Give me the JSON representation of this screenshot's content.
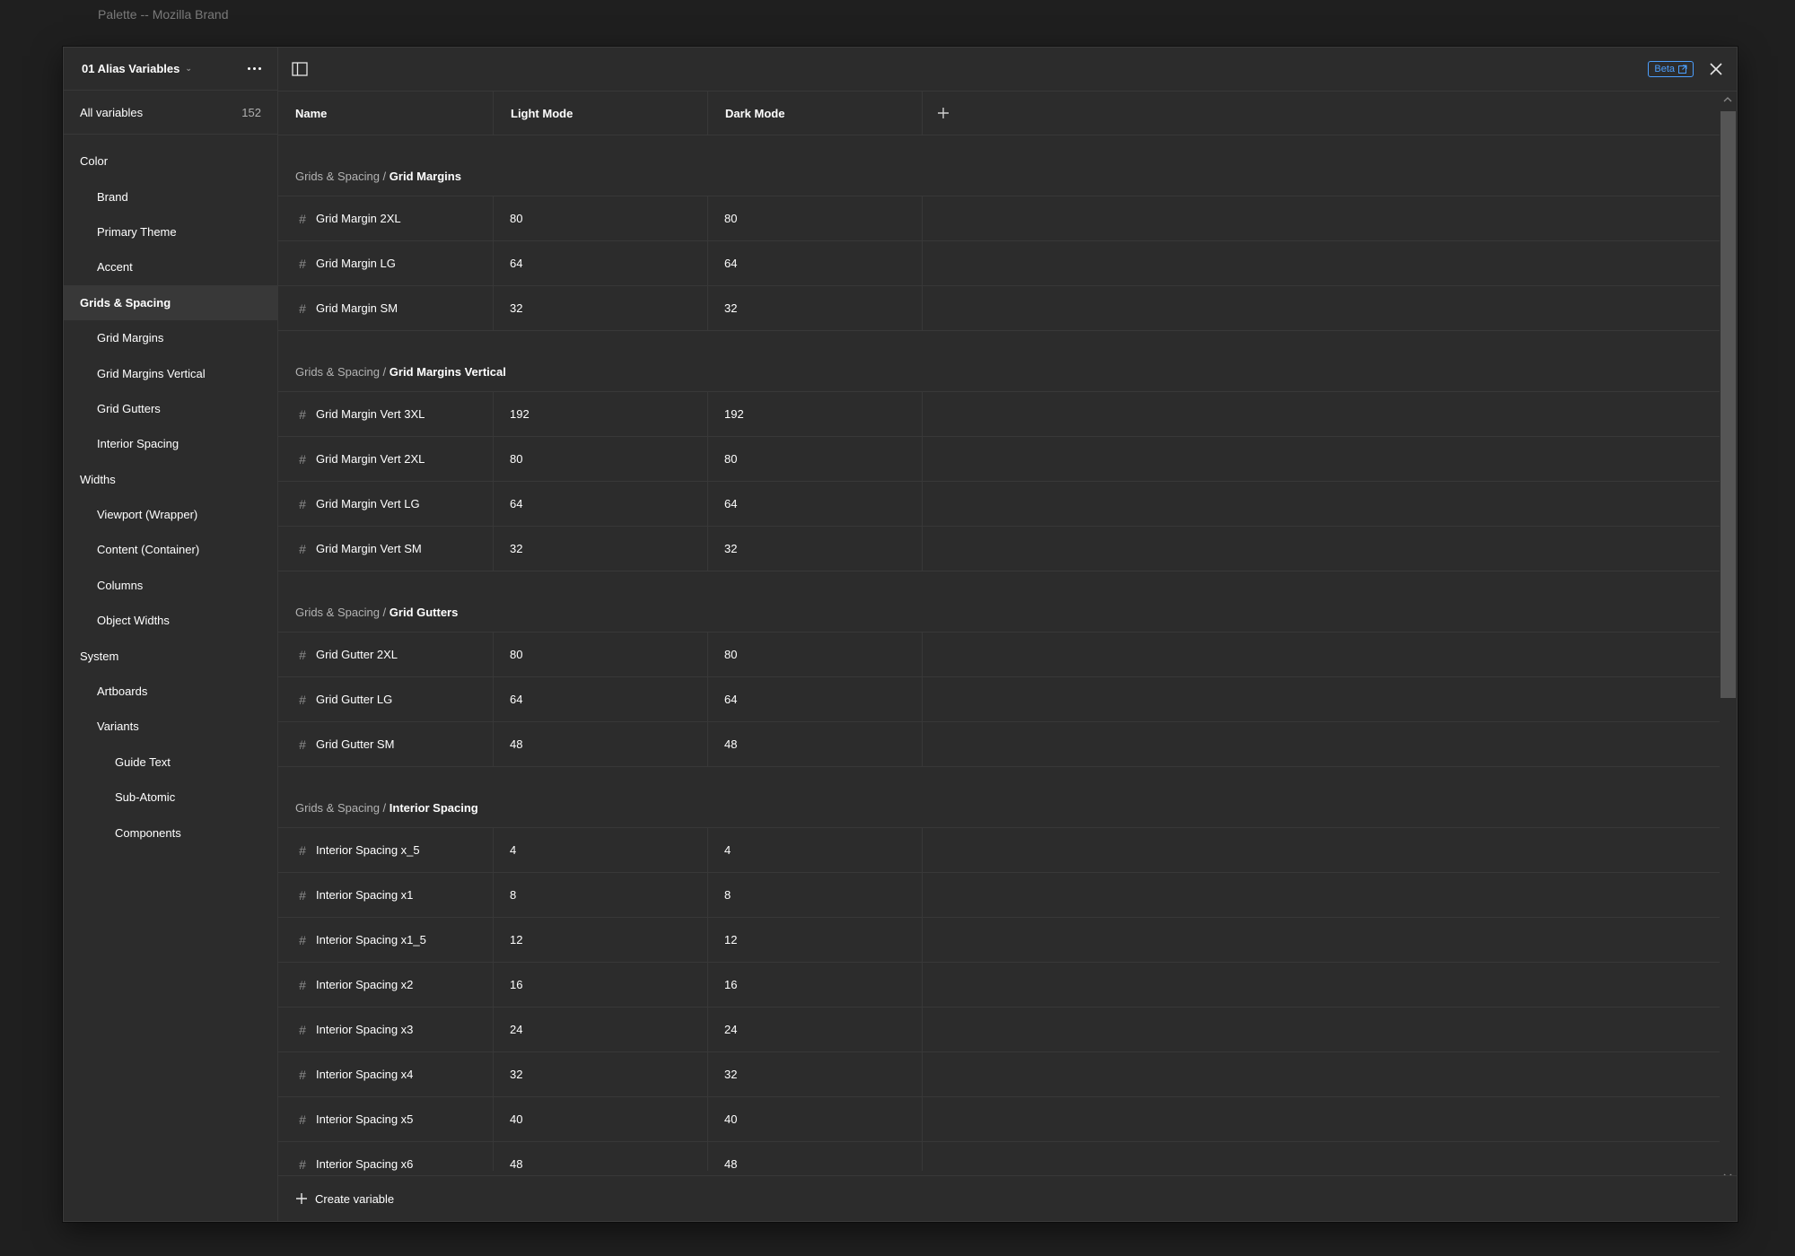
{
  "document_title": "Palette -- Mozilla Brand",
  "sidebar": {
    "collection_name": "01 Alias Variables",
    "all_variables_label": "All variables",
    "all_variables_count": "152",
    "groups": [
      {
        "label": "Color",
        "level": 0
      },
      {
        "label": "Brand",
        "level": 1
      },
      {
        "label": "Primary Theme",
        "level": 1
      },
      {
        "label": "Accent",
        "level": 1
      },
      {
        "label": "Grids & Spacing",
        "level": 0,
        "active": true
      },
      {
        "label": "Grid Margins",
        "level": 1
      },
      {
        "label": "Grid Margins Vertical",
        "level": 1
      },
      {
        "label": "Grid Gutters",
        "level": 1
      },
      {
        "label": "Interior Spacing",
        "level": 1
      },
      {
        "label": "Widths",
        "level": 0
      },
      {
        "label": "Viewport (Wrapper)",
        "level": 1
      },
      {
        "label": "Content (Container)",
        "level": 1
      },
      {
        "label": "Columns",
        "level": 1
      },
      {
        "label": "Object Widths",
        "level": 1
      },
      {
        "label": "System",
        "level": 0
      },
      {
        "label": "Artboards",
        "level": 1
      },
      {
        "label": "Variants",
        "level": 1
      },
      {
        "label": "Guide Text",
        "level": 2
      },
      {
        "label": "Sub-Atomic",
        "level": 2
      },
      {
        "label": "Components",
        "level": 2
      }
    ]
  },
  "topbar": {
    "beta_label": "Beta"
  },
  "table": {
    "columns": {
      "name": "Name",
      "light": "Light Mode",
      "dark": "Dark Mode"
    },
    "sections": [
      {
        "parent": "Grids & Spacing",
        "separator": " / ",
        "group": "Grid Margins",
        "rows": [
          {
            "name": "Grid Margin 2XL",
            "light": "80",
            "dark": "80"
          },
          {
            "name": "Grid Margin LG",
            "light": "64",
            "dark": "64"
          },
          {
            "name": "Grid Margin SM",
            "light": "32",
            "dark": "32"
          }
        ]
      },
      {
        "parent": "Grids & Spacing",
        "separator": " / ",
        "group": "Grid Margins Vertical",
        "rows": [
          {
            "name": "Grid Margin Vert 3XL",
            "light": "192",
            "dark": "192"
          },
          {
            "name": "Grid Margin Vert 2XL",
            "light": "80",
            "dark": "80"
          },
          {
            "name": "Grid Margin Vert LG",
            "light": "64",
            "dark": "64"
          },
          {
            "name": "Grid Margin Vert SM",
            "light": "32",
            "dark": "32"
          }
        ]
      },
      {
        "parent": "Grids & Spacing",
        "separator": " / ",
        "group": "Grid Gutters",
        "rows": [
          {
            "name": "Grid Gutter 2XL",
            "light": "80",
            "dark": "80"
          },
          {
            "name": "Grid Gutter LG",
            "light": "64",
            "dark": "64"
          },
          {
            "name": "Grid Gutter SM",
            "light": "48",
            "dark": "48"
          }
        ]
      },
      {
        "parent": "Grids & Spacing",
        "separator": " / ",
        "group": "Interior Spacing",
        "rows": [
          {
            "name": "Interior Spacing x_5",
            "light": "4",
            "dark": "4"
          },
          {
            "name": "Interior Spacing x1",
            "light": "8",
            "dark": "8"
          },
          {
            "name": "Interior Spacing x1_5",
            "light": "12",
            "dark": "12"
          },
          {
            "name": "Interior Spacing x2",
            "light": "16",
            "dark": "16"
          },
          {
            "name": "Interior Spacing x3",
            "light": "24",
            "dark": "24"
          },
          {
            "name": "Interior Spacing x4",
            "light": "32",
            "dark": "32"
          },
          {
            "name": "Interior Spacing x5",
            "light": "40",
            "dark": "40"
          },
          {
            "name": "Interior Spacing x6",
            "light": "48",
            "dark": "48"
          },
          {
            "name": "",
            "light": "",
            "dark": ""
          }
        ]
      }
    ]
  },
  "footer": {
    "create_label": "Create variable"
  },
  "icons": {
    "variable_type": "number-hash-icon",
    "panel_toggle": "sidebar-panel-icon",
    "close": "close-icon",
    "add_column": "plus-icon",
    "more": "more-dots-icon"
  },
  "colors": {
    "background": "#1f1f1f",
    "panel": "#2c2c2c",
    "border": "#383838",
    "accent": "#4c9ffe",
    "active_item": "#383838"
  }
}
